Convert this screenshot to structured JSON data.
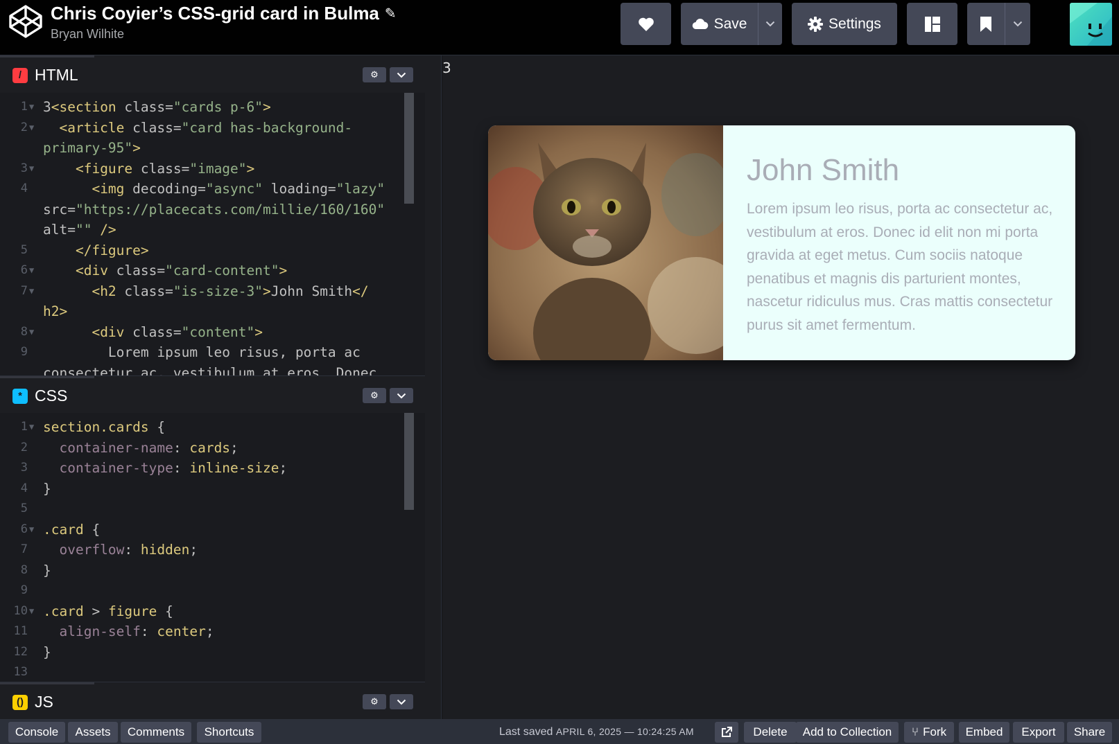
{
  "header": {
    "pen_title": "Chris Coyier’s CSS-grid card in Bulma",
    "author": "Bryan Wilhite",
    "save_label": "Save",
    "settings_label": "Settings"
  },
  "editors": {
    "html": {
      "label": "HTML",
      "lines": [
        {
          "n": "1",
          "fold": true,
          "parts": [
            [
              "plain",
              "3"
            ],
            [
              "tag",
              "<section "
            ],
            [
              "attr2",
              "class="
            ],
            [
              "str",
              "\"cards p-6\""
            ],
            [
              "tag",
              ">"
            ]
          ]
        },
        {
          "n": "2",
          "fold": true,
          "parts": [
            [
              "plain",
              "  "
            ],
            [
              "tag",
              "<article "
            ],
            [
              "attr2",
              "class="
            ],
            [
              "str",
              "\"card has-background-"
            ]
          ]
        },
        {
          "n": "",
          "fold": false,
          "parts": [
            [
              "str",
              "primary-95\""
            ],
            [
              "tag",
              ">"
            ]
          ]
        },
        {
          "n": "3",
          "fold": true,
          "parts": [
            [
              "plain",
              "    "
            ],
            [
              "tag",
              "<figure "
            ],
            [
              "attr2",
              "class="
            ],
            [
              "str",
              "\"image\""
            ],
            [
              "tag",
              ">"
            ]
          ]
        },
        {
          "n": "4",
          "fold": false,
          "parts": [
            [
              "plain",
              "      "
            ],
            [
              "tag",
              "<img "
            ],
            [
              "attr2",
              "decoding="
            ],
            [
              "str",
              "\"async\""
            ],
            [
              "attr2",
              " loading="
            ],
            [
              "str",
              "\"lazy\""
            ]
          ]
        },
        {
          "n": "",
          "fold": false,
          "parts": [
            [
              "attr2",
              "src="
            ],
            [
              "str",
              "\"https://placecats.com/millie/160/160\""
            ]
          ]
        },
        {
          "n": "",
          "fold": false,
          "parts": [
            [
              "attr2",
              "alt="
            ],
            [
              "str",
              "\"\""
            ],
            [
              "tag",
              " />"
            ]
          ]
        },
        {
          "n": "5",
          "fold": false,
          "parts": [
            [
              "plain",
              "    "
            ],
            [
              "tag",
              "</figure>"
            ]
          ]
        },
        {
          "n": "6",
          "fold": true,
          "parts": [
            [
              "plain",
              "    "
            ],
            [
              "tag",
              "<div "
            ],
            [
              "attr2",
              "class="
            ],
            [
              "str",
              "\"card-content\""
            ],
            [
              "tag",
              ">"
            ]
          ]
        },
        {
          "n": "7",
          "fold": true,
          "parts": [
            [
              "plain",
              "      "
            ],
            [
              "tag",
              "<h2 "
            ],
            [
              "attr2",
              "class="
            ],
            [
              "str",
              "\"is-size-3\""
            ],
            [
              "tag",
              ">"
            ],
            [
              "plain",
              "John Smith"
            ],
            [
              "tag",
              "</"
            ]
          ]
        },
        {
          "n": "",
          "fold": false,
          "parts": [
            [
              "tag",
              "h2>"
            ]
          ]
        },
        {
          "n": "8",
          "fold": true,
          "parts": [
            [
              "plain",
              "      "
            ],
            [
              "tag",
              "<div "
            ],
            [
              "attr2",
              "class="
            ],
            [
              "str",
              "\"content\""
            ],
            [
              "tag",
              ">"
            ]
          ]
        },
        {
          "n": "9",
          "fold": false,
          "parts": [
            [
              "plain",
              "        Lorem ipsum leo risus, porta ac"
            ]
          ]
        },
        {
          "n": "",
          "fold": false,
          "parts": [
            [
              "plain",
              "consectetur ac, vestibulum at eros. Donec"
            ]
          ]
        }
      ]
    },
    "css": {
      "label": "CSS",
      "lines": [
        {
          "n": "1",
          "fold": true,
          "parts": [
            [
              "sel",
              "section.cards"
            ],
            [
              "plain",
              " {"
            ]
          ]
        },
        {
          "n": "2",
          "fold": false,
          "parts": [
            [
              "plain",
              "  "
            ],
            [
              "prop",
              "container-name"
            ],
            [
              "plain",
              ": "
            ],
            [
              "val",
              "cards"
            ],
            [
              "plain",
              ";"
            ]
          ]
        },
        {
          "n": "3",
          "fold": false,
          "parts": [
            [
              "plain",
              "  "
            ],
            [
              "prop",
              "container-type"
            ],
            [
              "plain",
              ": "
            ],
            [
              "val",
              "inline-size"
            ],
            [
              "plain",
              ";"
            ]
          ]
        },
        {
          "n": "4",
          "fold": false,
          "parts": [
            [
              "plain",
              "}"
            ]
          ]
        },
        {
          "n": "5",
          "fold": false,
          "parts": []
        },
        {
          "n": "6",
          "fold": true,
          "parts": [
            [
              "sel",
              ".card"
            ],
            [
              "plain",
              " {"
            ]
          ]
        },
        {
          "n": "7",
          "fold": false,
          "parts": [
            [
              "plain",
              "  "
            ],
            [
              "prop",
              "overflow"
            ],
            [
              "plain",
              ": "
            ],
            [
              "val",
              "hidden"
            ],
            [
              "plain",
              ";"
            ]
          ]
        },
        {
          "n": "8",
          "fold": false,
          "parts": [
            [
              "plain",
              "}"
            ]
          ]
        },
        {
          "n": "9",
          "fold": false,
          "parts": []
        },
        {
          "n": "10",
          "fold": true,
          "parts": [
            [
              "sel",
              ".card"
            ],
            [
              "plain",
              " > "
            ],
            [
              "sel",
              "figure"
            ],
            [
              "plain",
              " {"
            ]
          ]
        },
        {
          "n": "11",
          "fold": false,
          "parts": [
            [
              "plain",
              "  "
            ],
            [
              "prop",
              "align-self"
            ],
            [
              "plain",
              ": "
            ],
            [
              "val",
              "center"
            ],
            [
              "plain",
              ";"
            ]
          ]
        },
        {
          "n": "12",
          "fold": false,
          "parts": [
            [
              "plain",
              "}"
            ]
          ]
        },
        {
          "n": "13",
          "fold": false,
          "parts": []
        }
      ]
    },
    "js": {
      "label": "JS"
    }
  },
  "preview": {
    "number": "3",
    "card_name": "John Smith",
    "card_text": "Lorem ipsum leo risus, porta ac consectetur ac, vestibulum at eros. Donec id elit non mi porta gravida at eget metus. Cum sociis natoque penatibus et magnis dis parturient montes, nascetur ridiculus mus. Cras mattis consectetur purus sit amet fermentum."
  },
  "footer": {
    "console": "Console",
    "assets": "Assets",
    "comments": "Comments",
    "shortcuts": "Shortcuts",
    "last_saved_label": "Last saved",
    "last_saved_stamp": "APRIL 6, 2025 — 10:24:25 AM",
    "delete": "Delete",
    "add_to_collection": "Add to Collection",
    "fork": "Fork",
    "embed": "Embed",
    "export": "Export",
    "share": "Share"
  },
  "colors": {
    "html_badge": "#ff3c41",
    "css_badge": "#0ebeff",
    "js_badge": "#fcd000",
    "card_bg": "#ebfffc"
  }
}
